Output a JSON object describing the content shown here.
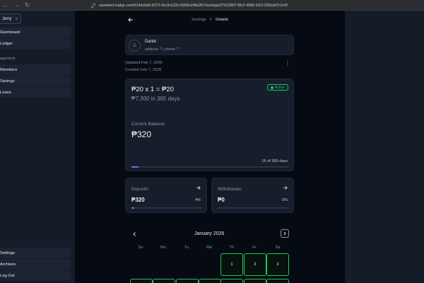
{
  "browser": {
    "url": "savelend.makje.com/614ec6a5-5373-4cc9-b22b-6993e246a307/savings/27623807-9fc2-4580-931f-250cdd7c2c0f",
    "back_icon": "arrow-left-icon",
    "forward_icon": "arrow-right-icon",
    "reload_icon": "reload-icon",
    "link_icon": "link-icon"
  },
  "sidebar": {
    "user": "Jerry",
    "section_label": "agement",
    "items_top": [
      {
        "label": "Dashboard"
      },
      {
        "label": "Ledger"
      }
    ],
    "items_management": [
      {
        "label": "Members"
      },
      {
        "label": "Savings"
      },
      {
        "label": "Loans"
      }
    ],
    "items_bottom": [
      {
        "label": "Settings"
      },
      {
        "label": "Archives"
      },
      {
        "label": "Log Out"
      }
    ]
  },
  "header": {
    "breadcrumb_parent": "Savings",
    "breadcrumb_current": "Details",
    "separator": ">"
  },
  "contact": {
    "initial": "D",
    "name": "Dante",
    "info": "address ? | phone ?"
  },
  "meta": {
    "updated": "Updated Feb 7, 2026",
    "created": "Created Feb 7, 2026"
  },
  "plan": {
    "status": "Active",
    "status_color": "#22c55e",
    "formula": "₱20 x 1 = ₱20",
    "duration": "₱7,300 in 365 days",
    "balance_label": "Current Balance",
    "balance_value": "₱320",
    "days_progress_text": "16 of 365 days",
    "days_progress": 0.044
  },
  "deposits": {
    "label": "Deposits",
    "value": "₱320",
    "percent": "4%",
    "progress": 0.04
  },
  "withdrawals": {
    "label": "Withdrawals",
    "value": "₱0",
    "percent": "0%",
    "progress": 0
  },
  "calendar": {
    "month": "January 2026",
    "weekdays": [
      "Su",
      "Mo",
      "Tu",
      "We",
      "Th",
      "Fr",
      "Sa"
    ],
    "days": [
      {
        "label": "1"
      },
      {
        "label": "2"
      },
      {
        "label": "3"
      }
    ]
  },
  "colors": {
    "accent": "#6b6ff0",
    "success": "#22c55e",
    "background": "#060a12",
    "card": "#161e2b",
    "sidebar": "#141c28"
  }
}
